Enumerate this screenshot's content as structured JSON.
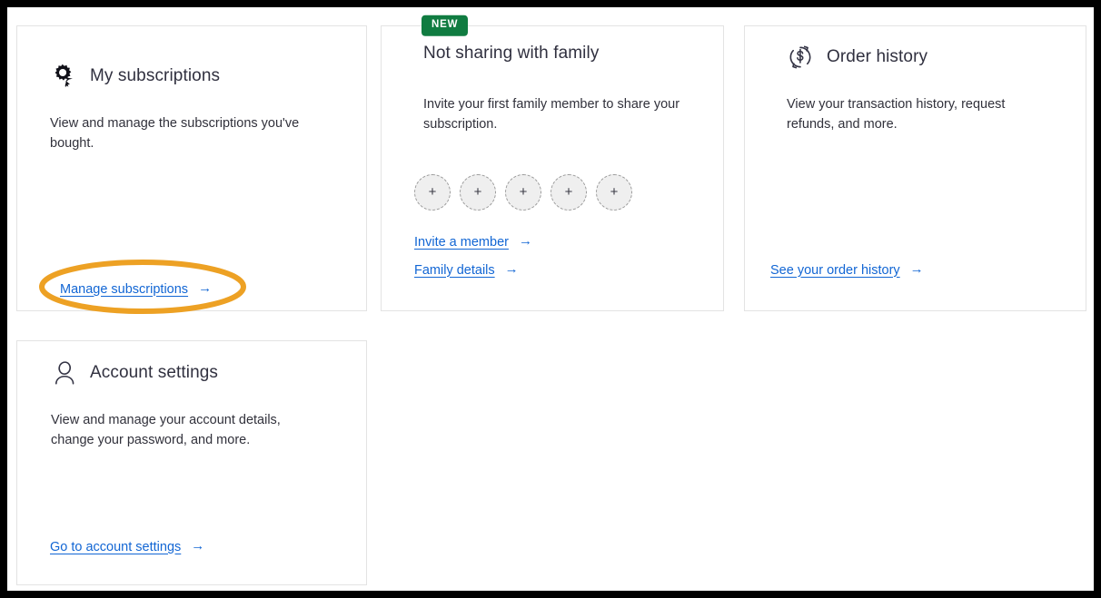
{
  "theme": {
    "page_background": "#ffffff",
    "outer_frame": "#000000",
    "card_border": "#e3e3e3",
    "title_color": "#30303f",
    "body_color": "#31313b",
    "link_color": "#1266d4",
    "badge_green": "#107c41",
    "highlight_orange": "#eda124",
    "avatar_fill": "#efefef",
    "avatar_border": "#9a9a9a"
  },
  "cards": {
    "subscriptions": {
      "icon": "gear-subscription-icon",
      "title": "My subscriptions",
      "body": "View and manage the subscriptions you've bought.",
      "link": {
        "label": "Manage subscriptions",
        "arrow": "→",
        "highlighted": true
      }
    },
    "family": {
      "badge": "NEW",
      "title": "Not sharing with family",
      "body": "Invite your first family member to share your subscription.",
      "avatar_slots": [
        "+",
        "+",
        "+",
        "+",
        "+"
      ],
      "links": [
        {
          "label": "Invite a member",
          "arrow": "→"
        },
        {
          "label": "Family details",
          "arrow": "→"
        }
      ]
    },
    "orders": {
      "icon": "dollar-refund-history-icon",
      "title": "Order history",
      "body": "View your transaction history, request refunds, and more.",
      "link": {
        "label": "See your order history",
        "arrow": "→"
      }
    },
    "account": {
      "icon": "person-account-icon",
      "title": "Account settings",
      "body": "View and manage your account details, change your password, and more.",
      "link": {
        "label": "Go to account settings",
        "arrow": "→"
      }
    }
  }
}
